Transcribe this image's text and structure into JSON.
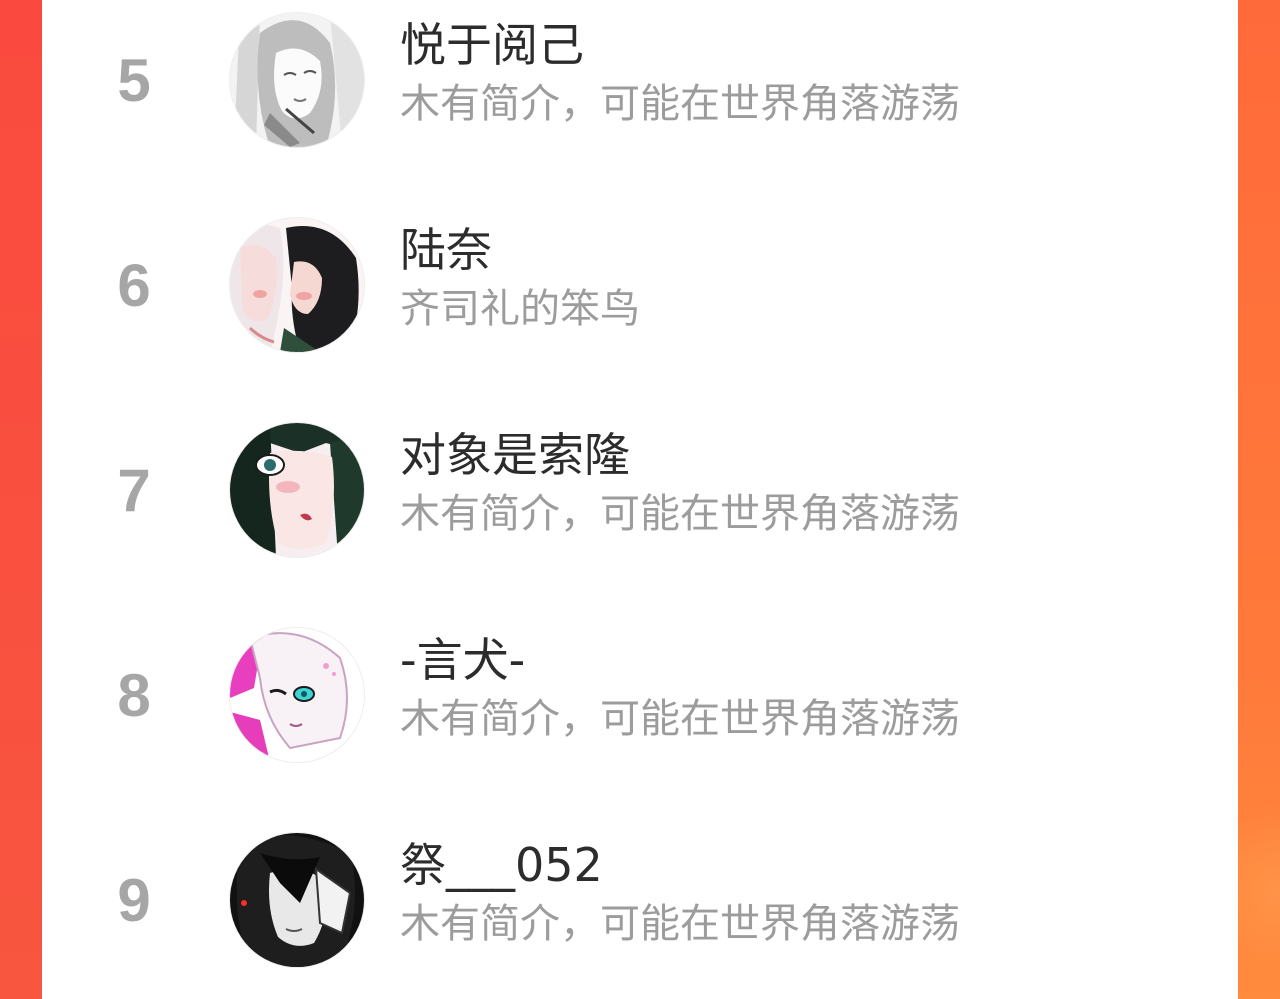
{
  "ranking": {
    "items": [
      {
        "rank": "5",
        "name": "悦于阅己",
        "bio": "木有简介，可能在世界角落游荡",
        "avatar_icon": "avatar-manga-woman-icon"
      },
      {
        "rank": "6",
        "name": "陆奈",
        "bio": "齐司礼的笨鸟",
        "avatar_icon": "avatar-couple-icon"
      },
      {
        "rank": "7",
        "name": "对象是索隆",
        "bio": "木有简介，可能在世界角落游荡",
        "avatar_icon": "avatar-dark-hair-girl-icon"
      },
      {
        "rank": "8",
        "name": "-言犬-",
        "bio": "木有简介，可能在世界角落游荡",
        "avatar_icon": "avatar-pink-girl-icon"
      },
      {
        "rank": "9",
        "name": "祭___052",
        "bio": "木有简介，可能在世界角落游荡",
        "avatar_icon": "avatar-monochrome-boy-icon"
      }
    ]
  },
  "colors": {
    "background_left": "#fa4a3f",
    "background_right": "#ff7b3a",
    "rank_text": "#a6a6a6",
    "name_text": "#2c2c2c",
    "bio_text": "#9c9c9c"
  }
}
